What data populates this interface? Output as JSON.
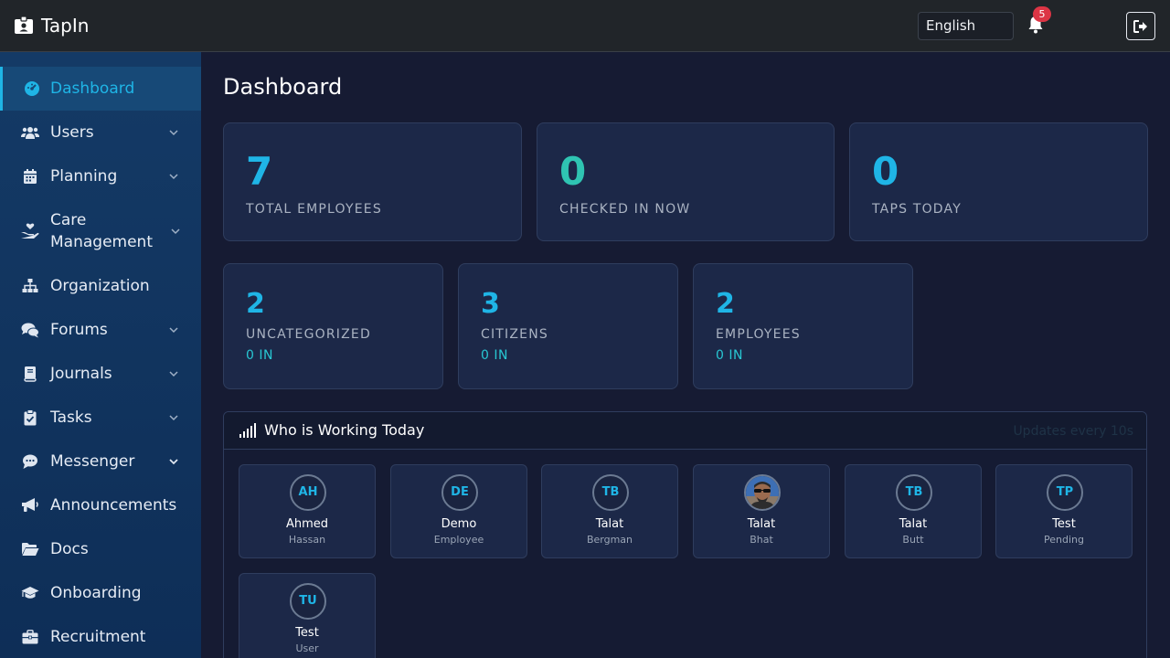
{
  "app": {
    "name": "TapIn"
  },
  "topbar": {
    "language": "English",
    "notifications_count": "5"
  },
  "sidebar": {
    "items": [
      {
        "label": "Dashboard",
        "icon": "dashboard-icon",
        "active": true,
        "expandable": false
      },
      {
        "label": "Users",
        "icon": "users-icon",
        "expandable": true
      },
      {
        "label": "Planning",
        "icon": "calendar-icon",
        "expandable": true
      },
      {
        "label": "Care Management",
        "icon": "hand-heart-icon",
        "expandable": true
      },
      {
        "label": "Organization",
        "icon": "sitemap-icon",
        "expandable": false
      },
      {
        "label": "Forums",
        "icon": "comments-icon",
        "expandable": true
      },
      {
        "label": "Journals",
        "icon": "book-icon",
        "expandable": true
      },
      {
        "label": "Tasks",
        "icon": "clipboard-check-icon",
        "expandable": true
      },
      {
        "label": "Messenger",
        "icon": "chat-icon",
        "expandable": true
      },
      {
        "label": "Announcements",
        "icon": "megaphone-icon",
        "expandable": false
      },
      {
        "label": "Docs",
        "icon": "folder-icon",
        "expandable": false
      },
      {
        "label": "Onboarding",
        "icon": "graduation-cap-icon",
        "expandable": false
      },
      {
        "label": "Recruitment",
        "icon": "briefcase-icon",
        "expandable": false
      }
    ]
  },
  "main": {
    "title": "Dashboard",
    "stats": [
      {
        "value": "7",
        "label": "TOTAL EMPLOYEES",
        "color": "#1fb5e6"
      },
      {
        "value": "0",
        "label": "CHECKED IN NOW",
        "color": "#2fc4b2"
      },
      {
        "value": "0",
        "label": "TAPS TODAY",
        "color": "#1fb5e6"
      }
    ],
    "groups": [
      {
        "value": "2",
        "label": "UNCATEGORIZED",
        "sub": "0 IN"
      },
      {
        "value": "3",
        "label": "CITIZENS",
        "sub": "0 IN"
      },
      {
        "value": "2",
        "label": "EMPLOYEES",
        "sub": "0 IN"
      }
    ],
    "working": {
      "title": "Who is Working Today",
      "note": "Updates every 10s",
      "people": [
        {
          "initials": "AH",
          "first": "Ahmed",
          "last": "Hassan",
          "photo": false
        },
        {
          "initials": "DE",
          "first": "Demo",
          "last": "Employee",
          "photo": false
        },
        {
          "initials": "TB",
          "first": "Talat",
          "last": "Bergman",
          "photo": false
        },
        {
          "initials": "",
          "first": "Talat",
          "last": "Bhat",
          "photo": true
        },
        {
          "initials": "TB",
          "first": "Talat",
          "last": "Butt",
          "photo": false
        },
        {
          "initials": "TP",
          "first": "Test",
          "last": "Pending",
          "photo": false
        },
        {
          "initials": "TU",
          "first": "Test",
          "last": "User",
          "photo": false
        }
      ]
    }
  },
  "colors": {
    "accent": "#1fb5e6",
    "teal": "#2fc4b2",
    "sidebar": "#143a66",
    "background": "#161b33",
    "badge": "#dc3545"
  }
}
